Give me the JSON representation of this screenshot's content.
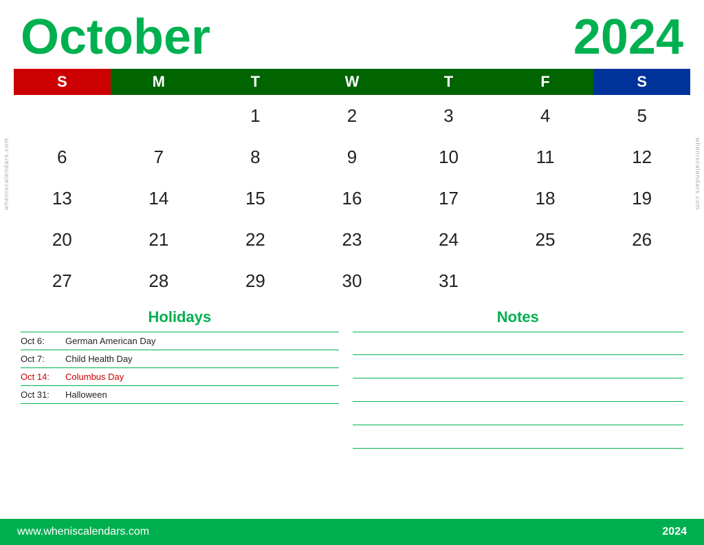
{
  "header": {
    "month": "October",
    "year": "2024"
  },
  "weekdays": [
    {
      "label": "S",
      "class": "th-sun"
    },
    {
      "label": "M",
      "class": "th-mon"
    },
    {
      "label": "T",
      "class": "th-tue"
    },
    {
      "label": "W",
      "class": "th-wed"
    },
    {
      "label": "T",
      "class": "th-thu"
    },
    {
      "label": "F",
      "class": "th-fri"
    },
    {
      "label": "S",
      "class": "th-sat"
    }
  ],
  "calendar_rows": [
    [
      "",
      "",
      "1",
      "2",
      "3",
      "4",
      "5"
    ],
    [
      "6",
      "7",
      "8",
      "9",
      "10",
      "11",
      "12"
    ],
    [
      "13",
      "14",
      "15",
      "16",
      "17",
      "18",
      "19"
    ],
    [
      "20",
      "21",
      "22",
      "23",
      "24",
      "25",
      "26"
    ],
    [
      "27",
      "28",
      "29",
      "30",
      "31",
      "",
      ""
    ]
  ],
  "holidays_title": "Holidays",
  "holidays": [
    {
      "date": "Oct 6:",
      "name": "German American Day",
      "red": false
    },
    {
      "date": "Oct 7:",
      "name": "Child Health Day",
      "red": false
    },
    {
      "date": "Oct 14:",
      "name": "Columbus Day",
      "red": true
    },
    {
      "date": "Oct 31:",
      "name": "Halloween",
      "red": false
    }
  ],
  "notes_title": "Notes",
  "notes_lines": 5,
  "footer": {
    "url": "www.wheniscalendars.com",
    "year": "2024"
  },
  "watermark": "wheniscalendars.com"
}
